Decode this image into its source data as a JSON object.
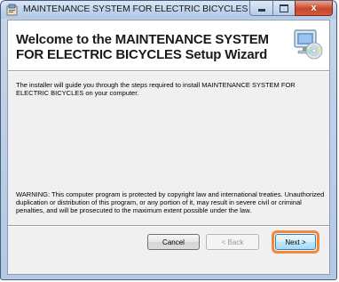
{
  "window": {
    "title": "MAINTENANCE SYSTEM FOR ELECTRIC BICYCLES",
    "close_glyph": "x"
  },
  "header": {
    "welcome": "Welcome to the MAINTENANCE SYSTEM FOR ELECTRIC BICYCLES Setup Wizard",
    "icon": "computer-cd-install-icon"
  },
  "body": {
    "intro": "The installer will guide you through the steps required to install MAINTENANCE SYSTEM FOR ELECTRIC BICYCLES on your computer.",
    "warning": "WARNING: This computer program is protected by copyright law and international treaties. Unauthorized duplication or distribution of this program, or any portion of it, may result in severe civil or criminal penalties, and will be prosecuted to the maximum extent possible under the law."
  },
  "buttons": {
    "cancel": "Cancel",
    "back": "< Back",
    "next": "Next >"
  },
  "colors": {
    "highlight": "#f0893b",
    "close_button": "#c9472c"
  }
}
